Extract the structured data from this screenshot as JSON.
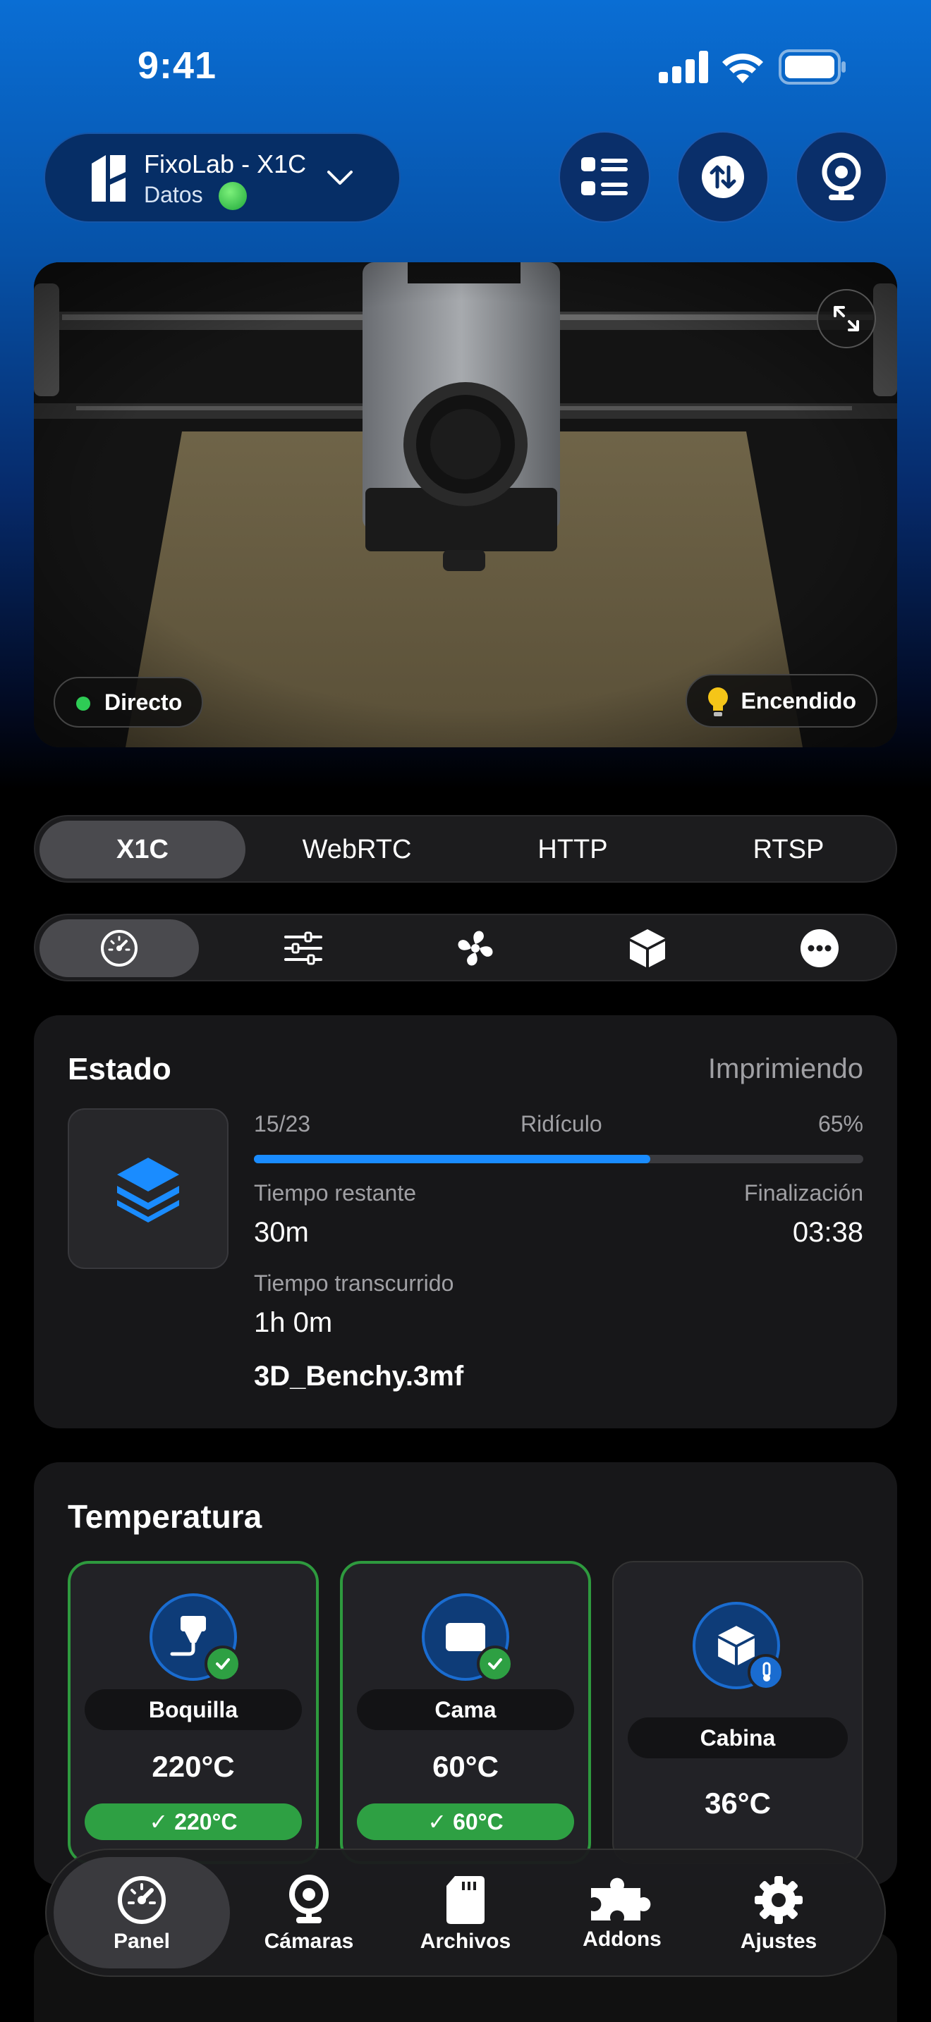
{
  "status_bar": {
    "time": "9:41"
  },
  "device": {
    "name": "FixoLab - X1C",
    "subtitle": "Datos"
  },
  "camera": {
    "live_label": "Directo",
    "light_label": "Encendido"
  },
  "stream_tabs": [
    "X1C",
    "WebRTC",
    "HTTP",
    "RTSP"
  ],
  "control_tab_icons": [
    "speedometer-icon",
    "sliders-icon",
    "fan-icon",
    "box-icon",
    "more-icon"
  ],
  "status_card": {
    "title": "Estado",
    "state": "Imprimiendo",
    "layer": "15/23",
    "speed": "Ridículo",
    "percent": "65%",
    "progress": 0.65,
    "remaining_label": "Tiempo restante",
    "remaining_value": "30m",
    "finish_label": "Finalización",
    "finish_value": "03:38",
    "elapsed_label": "Tiempo transcurrido",
    "elapsed_value": "1h 0m",
    "file_name": "3D_Benchy.3mf"
  },
  "temperature_card": {
    "title": "Temperatura",
    "items": [
      {
        "label": "Boquilla",
        "value": "220°C",
        "target": "✓ 220°C"
      },
      {
        "label": "Cama",
        "value": "60°C",
        "target": "✓ 60°C"
      },
      {
        "label": "Cabina",
        "value": "36°C"
      }
    ]
  },
  "tab_bar": {
    "items": [
      {
        "label": "Panel",
        "icon": "gauge-icon"
      },
      {
        "label": "Cámaras",
        "icon": "webcam-icon"
      },
      {
        "label": "Archivos",
        "icon": "sd-card-icon"
      },
      {
        "label": "Addons",
        "icon": "puzzle-icon"
      },
      {
        "label": "Ajustes",
        "icon": "gear-icon"
      }
    ]
  },
  "colors": {
    "accent": "#1a8cff",
    "success": "#2ea043",
    "background": "#000000",
    "card": "#171719"
  }
}
